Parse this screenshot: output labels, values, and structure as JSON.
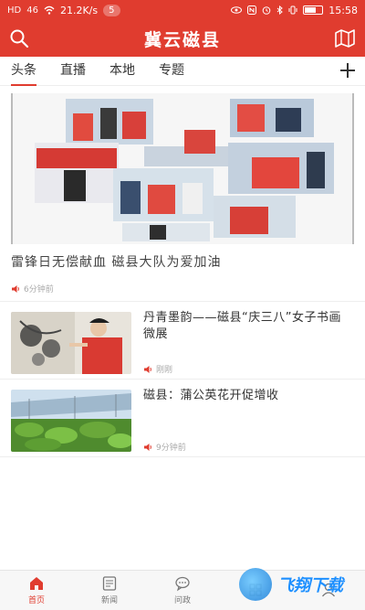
{
  "status_bar": {
    "network": "HD",
    "signal": "46",
    "speed": "21.2K/s",
    "notification_count": "5",
    "time": "15:58"
  },
  "header": {
    "title": "冀云磁县"
  },
  "tabs": [
    {
      "label": "头条",
      "active": true
    },
    {
      "label": "直播",
      "active": false
    },
    {
      "label": "本地",
      "active": false
    },
    {
      "label": "专题",
      "active": false
    }
  ],
  "hero": {
    "title": "雷锋日无偿献血 磁县大队为爱加油",
    "time": "6分钟前"
  },
  "articles": [
    {
      "title": "丹青墨韵——磁县“庆三八”女子书画微展",
      "time": "刚刚"
    },
    {
      "title": "磁县：蒲公英花开促增收",
      "time": "9分钟前"
    }
  ],
  "bottom_nav": [
    {
      "label": "首页",
      "icon": "home-icon",
      "active": true
    },
    {
      "label": "新闻",
      "icon": "news-icon",
      "active": false
    },
    {
      "label": "问政",
      "icon": "chat-icon",
      "active": false
    },
    {
      "label": "",
      "icon": "service-icon",
      "active": false
    },
    {
      "label": "",
      "icon": "profile-icon",
      "active": false
    }
  ],
  "watermark": {
    "text": "飞翔下载"
  },
  "colors": {
    "accent": "#e03c2f",
    "muted": "#aaaaaa"
  }
}
